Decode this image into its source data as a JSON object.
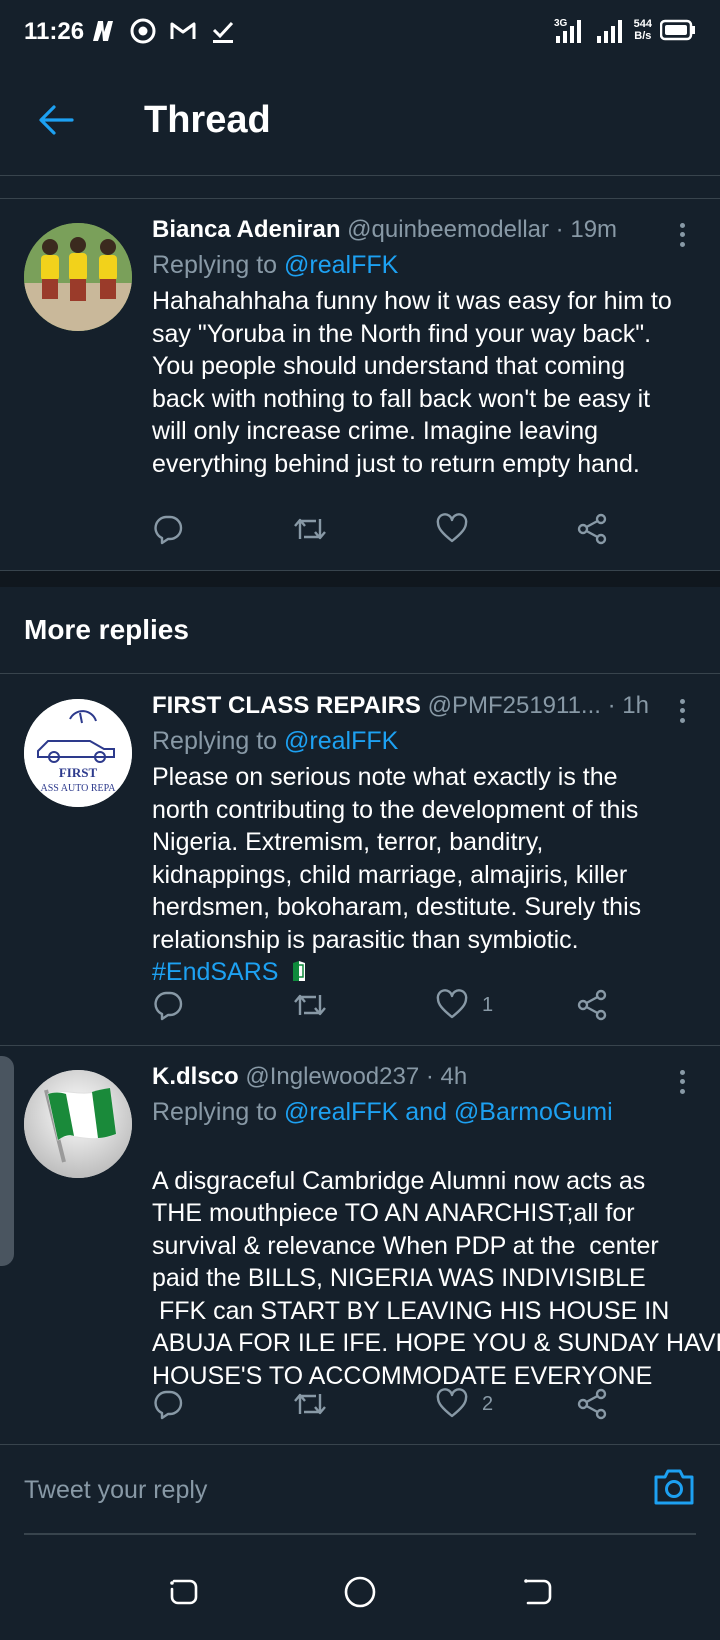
{
  "status_bar": {
    "time": "11:26",
    "network_type": "3G",
    "speed_value": "544",
    "speed_unit": "B/s",
    "icons": [
      "n-app-icon",
      "chrome-icon",
      "gmail-icon",
      "check-icon",
      "signal-icon",
      "signal-icon-2",
      "battery-icon"
    ]
  },
  "header": {
    "title": "Thread",
    "back_icon": "arrow-left-icon"
  },
  "colors": {
    "background": "#15202b",
    "accent": "#1da1f2",
    "secondary_text": "#8899a6",
    "divider": "#38444d"
  },
  "tweets": [
    {
      "name": "Bianca Adeniran",
      "handle": "@quinbeemodellar",
      "dot": "·",
      "time": "19m",
      "replying_prefix": "Replying to ",
      "replying_to": "@realFFK",
      "text": "Hahahahhaha funny how it was easy for him to say \"Yoruba in the North find your way back\". You people should understand that coming back with nothing to fall back won't be easy it will only increase crime. Imagine leaving everything behind just to return empty hand.",
      "likes": ""
    },
    {
      "name": "FIRST CLASS REPAIRS",
      "handle": "@PMF251911...",
      "dot": "·",
      "time": "1h",
      "replying_prefix": "Replying to ",
      "replying_to": "@realFFK",
      "text": "Please on serious note what exactly is the north contributing to the development of this Nigeria. Extremism, terror, banditry, kidnappings, child marriage, almajiris, killer herdsmen, bokoharam, destitute. Surely this relationship is parasitic than symbiotic. ",
      "hashtag": "#EndSARS",
      "avatar_text_1": "FIRST",
      "avatar_text_2": "ASS AUTO REPA",
      "likes": "1"
    },
    {
      "name": "K.dlsco",
      "handle": "@Inglewood237",
      "dot": "·",
      "time": "4h",
      "replying_prefix": "Replying to ",
      "replying_to": "@realFFK and @BarmoGumi",
      "text_lines": [
        "A disgraceful Cambridge Alumni now acts as",
        "THE mouthpiece TO AN ANARCHIST;all for",
        "survival & relevance When PDP at the  center",
        "paid the BILLS, NIGERIA WAS INDIVISIBLE",
        " FFK can START BY LEAVING HIS HOUSE IN",
        "ABUJA FOR ILE IFE. HOPE YOU & SUNDAY HAVE",
        "HOUSE'S TO ACCOMMODATE EVERYONE"
      ],
      "likes": "2"
    }
  ],
  "more_replies": {
    "title": "More replies"
  },
  "reply_bar": {
    "placeholder": "Tweet your reply",
    "camera_icon": "camera-icon"
  },
  "nav_bar": {
    "icons": [
      "recents-icon",
      "home-icon",
      "back-icon"
    ]
  }
}
